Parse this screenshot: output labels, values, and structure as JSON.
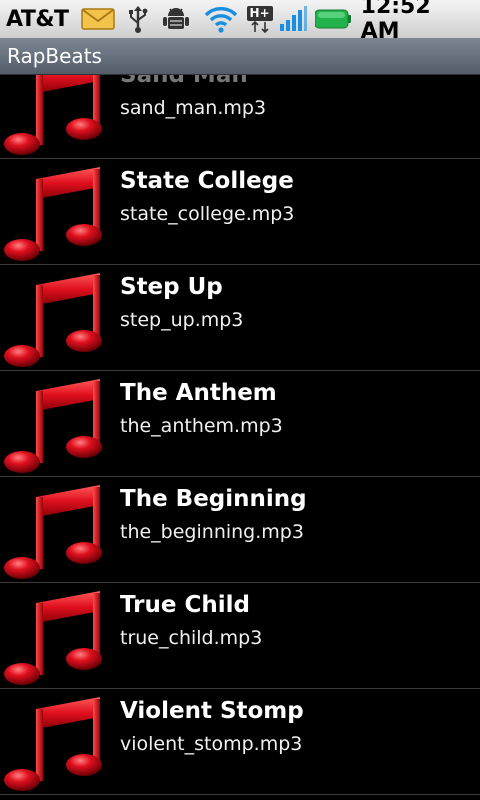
{
  "status_bar": {
    "carrier": "AT&T",
    "network_badge": "H+",
    "time": "12:52 AM",
    "icons": [
      "email-icon",
      "usb-icon",
      "android-debug-icon",
      "wifi-icon",
      "network-type-icon",
      "signal-icon",
      "battery-icon"
    ],
    "battery_color": "#22b24c"
  },
  "app": {
    "title": "RapBeats"
  },
  "songs": [
    {
      "title": "Sand Man",
      "file": "sand_man.mp3"
    },
    {
      "title": "State College",
      "file": "state_college.mp3"
    },
    {
      "title": "Step Up",
      "file": "step_up.mp3"
    },
    {
      "title": "The Anthem",
      "file": "the_anthem.mp3"
    },
    {
      "title": "The Beginning",
      "file": "the_beginning.mp3"
    },
    {
      "title": "True Child",
      "file": "true_child.mp3"
    },
    {
      "title": "Violent Stomp",
      "file": "violent_stomp.mp3"
    }
  ],
  "colors": {
    "note_red": "#e0101e",
    "list_background": "#000000",
    "title_bar": "#6b7480"
  }
}
